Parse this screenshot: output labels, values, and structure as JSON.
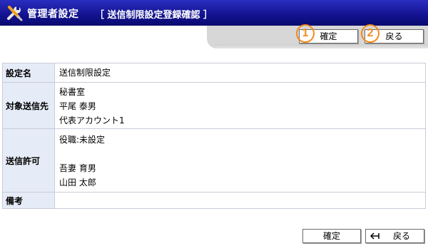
{
  "header": {
    "title": "管理者設定",
    "subtitle": "［ 送信制限設定登録確認 ］",
    "icon": "tools-icon"
  },
  "toolbar_top": {
    "confirm_label": "確定",
    "back_label": "戻る",
    "marker_1": "1",
    "marker_2": "2"
  },
  "table": {
    "name_label": "設定名",
    "name_value": "送信制限設定",
    "dest_label": "対象送信先",
    "dest_values": [
      "秘書室",
      "平尾 泰男",
      "代表アカウント1"
    ],
    "perm_label": "送信許可",
    "perm_values": [
      "役職:未設定",
      "",
      "吾妻 育男",
      "山田 太郎"
    ],
    "note_label": "備考",
    "note_value": ""
  },
  "toolbar_bottom": {
    "confirm_label": "確定",
    "back_label": "戻る"
  },
  "colors": {
    "header_bg": "#12128f",
    "label_bg": "#e6ecf7",
    "marker": "#f28c1e"
  }
}
